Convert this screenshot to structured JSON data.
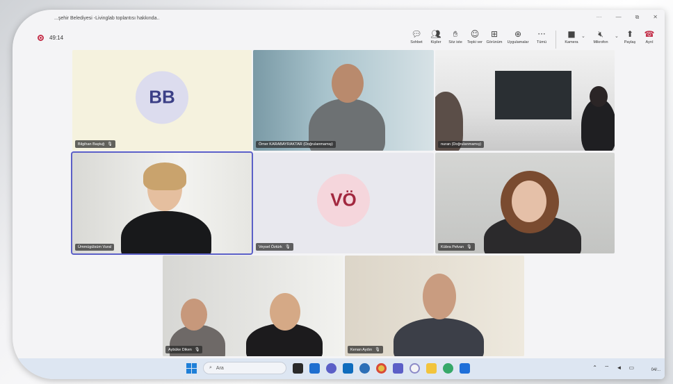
{
  "window": {
    "title": "...şehir Belediyesi -Livinglab toplantısı hakkında..",
    "controls": [
      "···",
      "—",
      "⧉",
      "✕"
    ]
  },
  "meeting": {
    "timer": "49:14"
  },
  "toolbar": {
    "items": [
      {
        "label": "Sohbet",
        "icon": "chat-icon"
      },
      {
        "label": "Kişiler",
        "icon": "people-icon"
      },
      {
        "label": "Söz iste",
        "icon": "raise-hand-icon"
      },
      {
        "label": "Tepki ver",
        "icon": "react-icon"
      },
      {
        "label": "Görünüm",
        "icon": "view-icon"
      },
      {
        "label": "Uygulamalar",
        "icon": "apps-icon"
      },
      {
        "label": "Tümü",
        "icon": "more-icon"
      }
    ],
    "camera_label": "Kamera",
    "mic_label": "Mikrofon",
    "share_label": "Paylaş",
    "leave_label": "Ayrıl"
  },
  "participants": [
    {
      "name": "Bilgihan Baştuğ",
      "initials": "BB",
      "muted": true
    },
    {
      "name": "Ömer KARABAYRAKTAR (Doğrulanmamış)",
      "muted": false
    },
    {
      "name": "nuran (Doğrulanmamış)",
      "muted": false
    },
    {
      "name": "Ümmügülsüm Vural",
      "muted": false
    },
    {
      "name": "Veysel Öztürk",
      "initials": "VÖ",
      "muted": true
    },
    {
      "name": "Kübra Pelvan",
      "muted": true
    },
    {
      "name": "Aybüke Diken",
      "muted": true
    },
    {
      "name": "Kenan Aydın",
      "muted": true
    }
  ],
  "taskbar": {
    "search_placeholder": "Ara",
    "date": "04/..."
  },
  "colors": {
    "accent": "#5b5fc7",
    "leave": "#c4314b",
    "bb_avatar": "#dcdcee",
    "vo_avatar": "#f5d6dc"
  }
}
